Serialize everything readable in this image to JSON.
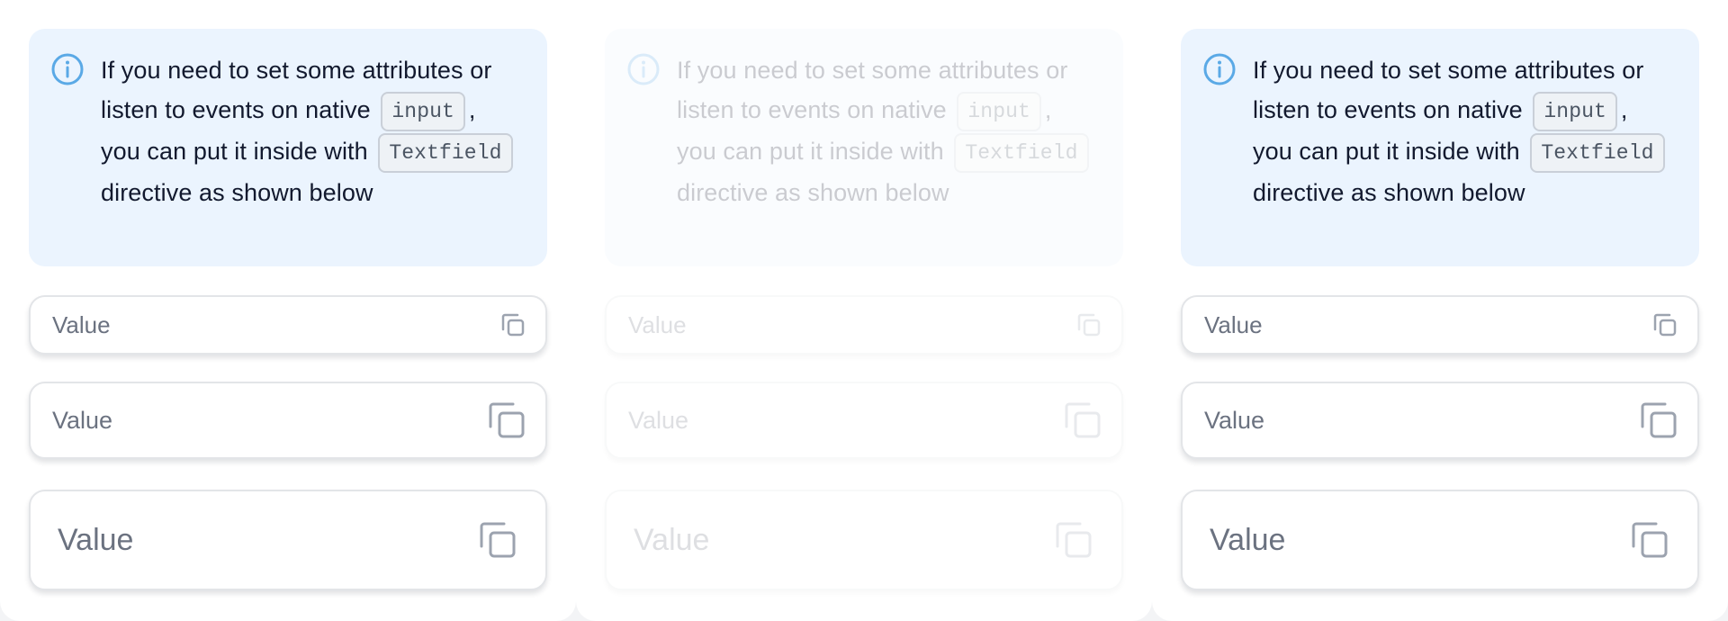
{
  "colors": {
    "alert_background": "#ebf4fe",
    "info_icon": "#5aa9e6",
    "field_border": "#e3e5e8",
    "placeholder_text": "#6b7280",
    "copy_icon": "#9ca3af"
  },
  "icons": {
    "info": "info-circle-icon",
    "copy": "copy-icon"
  },
  "columns": [
    {
      "state": "default",
      "alert": {
        "text_before_input": "If you need to set some attributes or listen to events on native",
        "input_code": "input",
        "text_after_input": ", you can put it inside with",
        "textfield_code": "Textfield",
        "text_after_textfield": "directive as shown below"
      },
      "fields": [
        {
          "size": "small",
          "value": "Value"
        },
        {
          "size": "medium",
          "value": "Value"
        },
        {
          "size": "large",
          "value": "Value"
        }
      ]
    },
    {
      "state": "disabled",
      "alert": {
        "text_before_input": "If you need to set some attributes or listen to events on native",
        "input_code": "input",
        "text_after_input": ", you can put it inside with",
        "textfield_code": "Textfield",
        "text_after_textfield": "directive as shown below"
      },
      "fields": [
        {
          "size": "small",
          "value": "Value"
        },
        {
          "size": "medium",
          "value": "Value"
        },
        {
          "size": "large",
          "value": "Value"
        }
      ]
    },
    {
      "state": "default",
      "alert": {
        "text_before_input": "If you need to set some attributes or listen to events on native",
        "input_code": "input",
        "text_after_input": ", you can put it inside with",
        "textfield_code": "Textfield",
        "text_after_textfield": "directive as shown below"
      },
      "fields": [
        {
          "size": "small",
          "value": "Value"
        },
        {
          "size": "medium",
          "value": "Value"
        },
        {
          "size": "large",
          "value": "Value"
        }
      ]
    }
  ]
}
